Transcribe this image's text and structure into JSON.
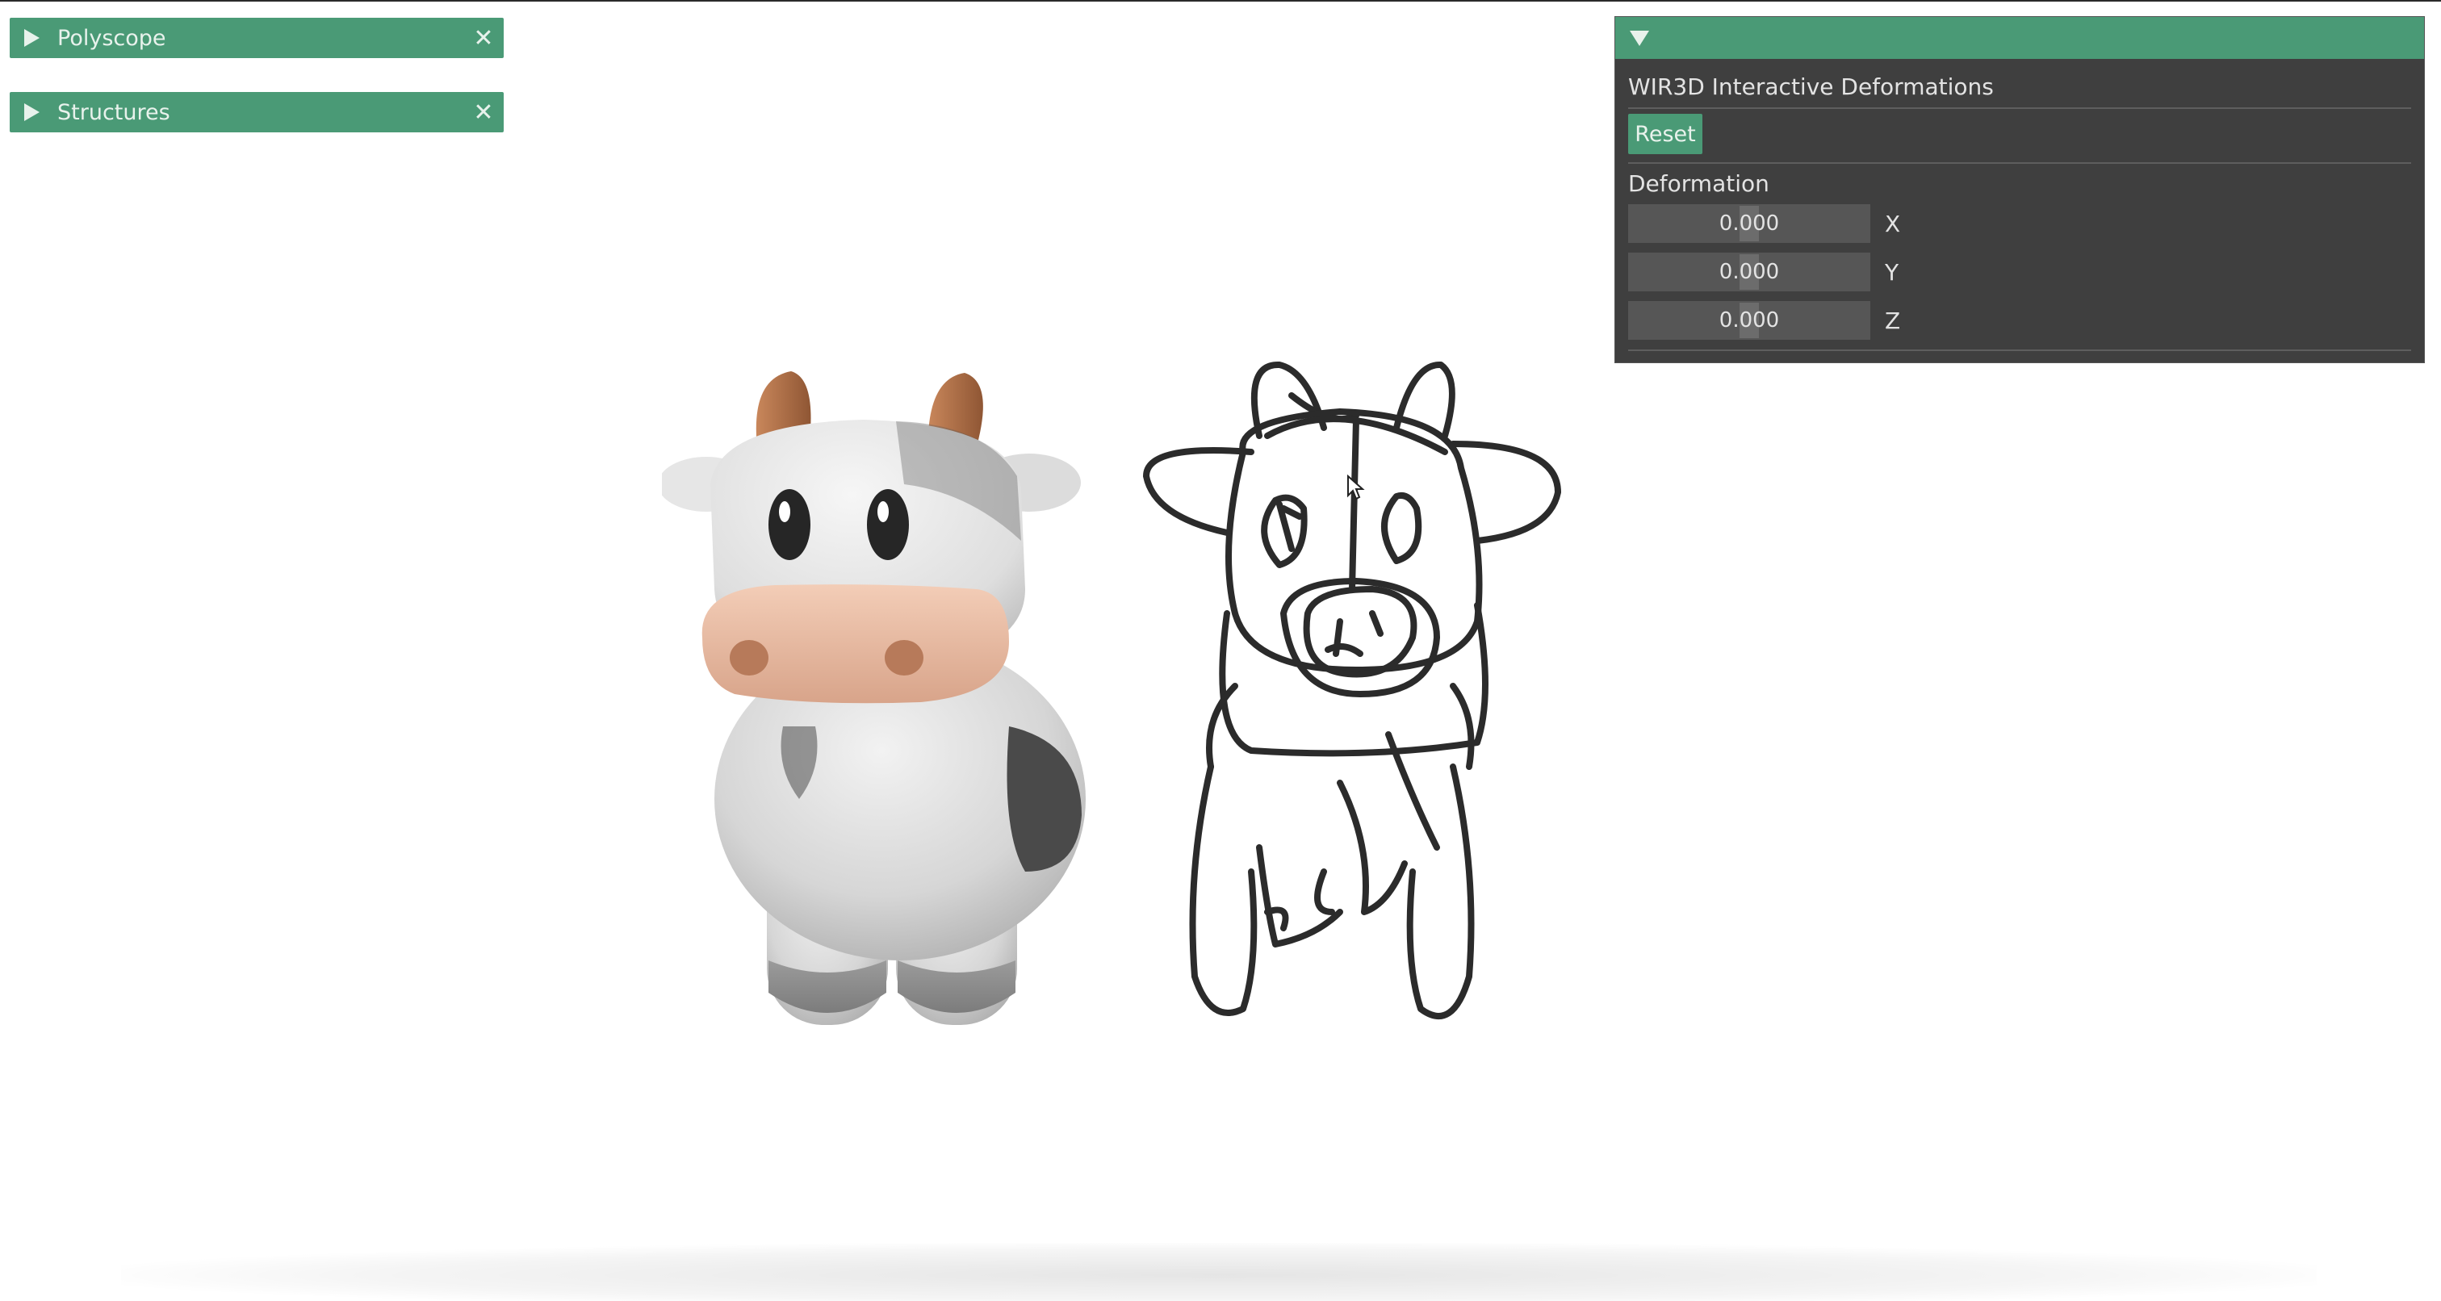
{
  "panels": {
    "polyscope": {
      "label": "Polyscope"
    },
    "structures": {
      "label": "Structures"
    }
  },
  "wir3d": {
    "title": "WIR3D Interactive Deformations",
    "reset_label": "Reset",
    "section_label": "Deformation",
    "fields": [
      {
        "value": "0.000",
        "axis": "X"
      },
      {
        "value": "0.000",
        "axis": "Y"
      },
      {
        "value": "0.000",
        "axis": "Z"
      }
    ]
  },
  "icons": {
    "collapse": "triangle-right-icon",
    "expand": "triangle-down-icon",
    "close": "close-icon"
  },
  "colors": {
    "accent": "#4a9a76",
    "panel_bg": "#3f3f3f",
    "field_bg": "#565656",
    "background": "#ffffff"
  }
}
